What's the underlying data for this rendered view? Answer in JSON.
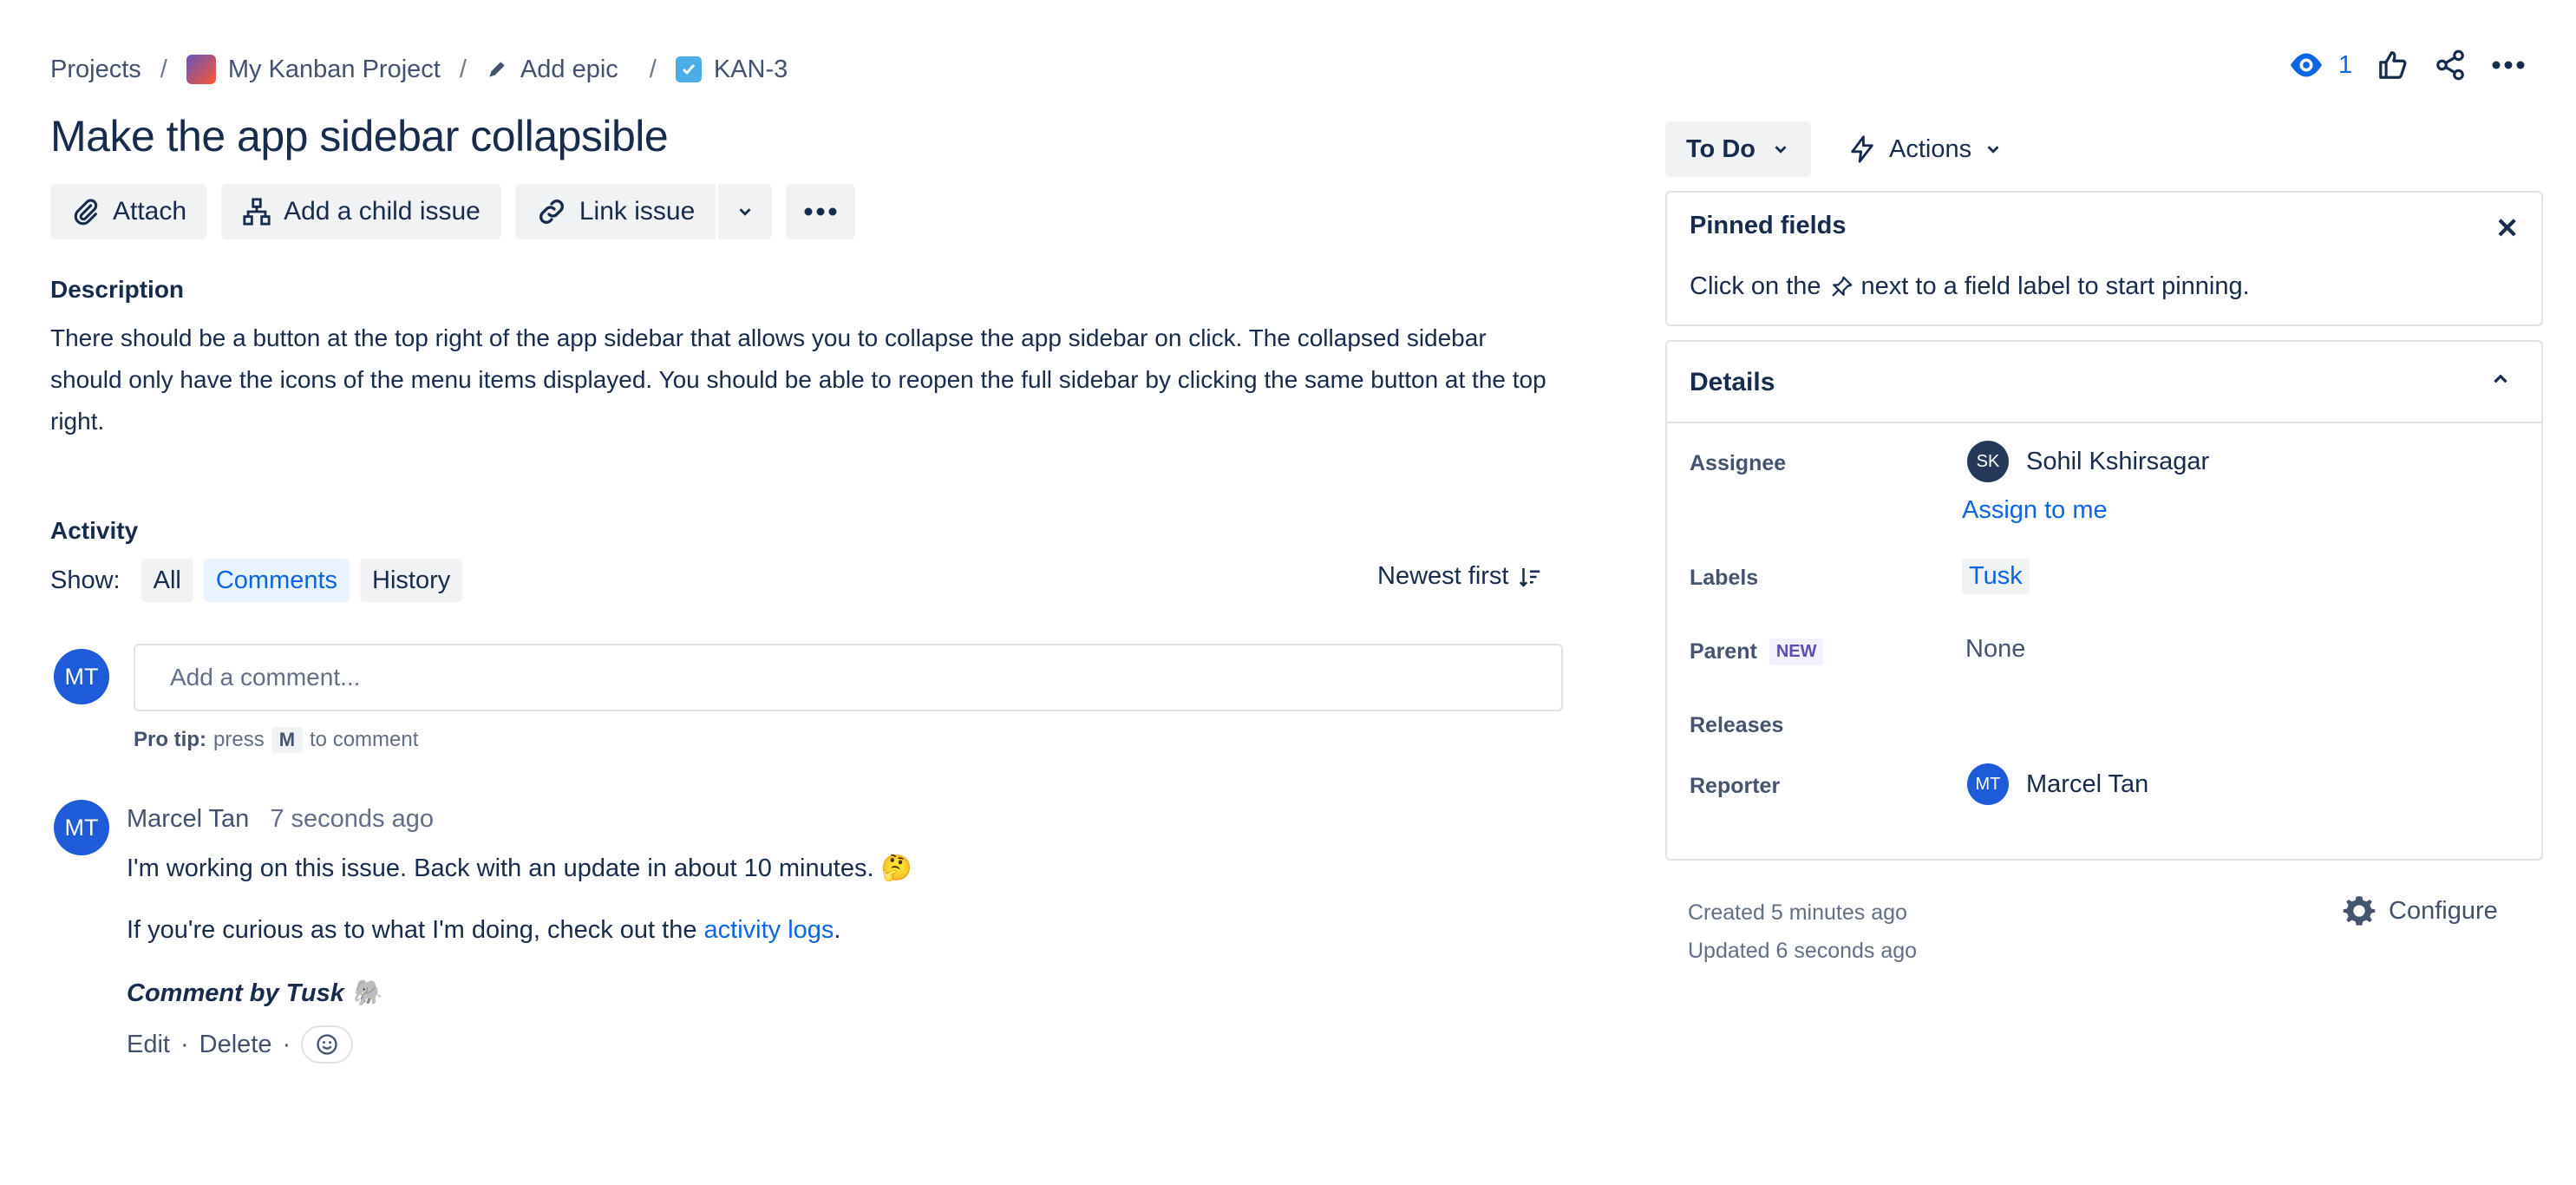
{
  "breadcrumb": {
    "projects": "Projects",
    "project": "My Kanban Project",
    "add_epic": "Add epic",
    "issue_key": "KAN-3",
    "separator": "/"
  },
  "issue": {
    "title": "Make the app sidebar collapsible"
  },
  "toolbar": {
    "attach": "Attach",
    "add_child": "Add a child issue",
    "link_issue": "Link issue"
  },
  "description": {
    "label": "Description",
    "text": "There should be a button at the top right of the app sidebar that allows you to collapse the app sidebar on click. The collapsed sidebar should only have the icons of the menu items displayed. You should be able to reopen the full sidebar by clicking the same button at the top right."
  },
  "activity": {
    "label": "Activity",
    "show_label": "Show:",
    "filters": [
      "All",
      "Comments",
      "History"
    ],
    "selected_filter": "Comments",
    "sort": "Newest first",
    "comment_placeholder": "Add a comment...",
    "current_user_initials": "MT",
    "protip": {
      "prefix": "Pro tip:",
      "middle": "press",
      "key": "M",
      "suffix": "to comment"
    }
  },
  "comment": {
    "author_initials": "MT",
    "author": "Marcel Tan",
    "time": "7 seconds ago",
    "line1": "I'm working on this issue. Back with an update in about 10 minutes. 🤔",
    "line2_prefix": "If you're curious as to what I'm doing, check out the ",
    "line2_link": "activity logs",
    "line2_suffix": ".",
    "signature": "Comment by Tusk 🐘",
    "edit": "Edit",
    "delete": "Delete",
    "dot": "·"
  },
  "header_actions": {
    "watchers_count": "1",
    "icons": [
      "eye-icon",
      "thumbs-up-icon",
      "share-icon",
      "more-icon"
    ]
  },
  "status": {
    "label": "To Do",
    "actions": "Actions"
  },
  "pinned": {
    "title": "Pinned fields",
    "hint_prefix": "Click on the",
    "hint_suffix": "next to a field label to start pinning."
  },
  "details": {
    "title": "Details",
    "assignee_label": "Assignee",
    "assignee_initials": "SK",
    "assignee_name": "Sohil Kshirsagar",
    "assign_to_me": "Assign to me",
    "labels_label": "Labels",
    "labels_value": "Tusk",
    "parent_label": "Parent",
    "parent_badge": "NEW",
    "parent_value": "None",
    "releases_label": "Releases",
    "reporter_label": "Reporter",
    "reporter_initials": "MT",
    "reporter_name": "Marcel Tan"
  },
  "meta": {
    "created": "Created 5 minutes ago",
    "updated": "Updated 6 seconds ago",
    "configure": "Configure"
  },
  "colors": {
    "accent": "#0c66e4",
    "avatar_blue": "#1d5bd8",
    "avatar_dark": "#253858",
    "text": "#172b4d",
    "subtle_bg": "#f1f2f4",
    "border": "#dfe1e6"
  }
}
